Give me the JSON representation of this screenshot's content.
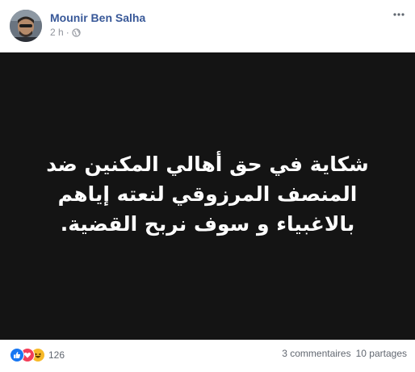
{
  "post": {
    "author": "Mounir Ben Salha",
    "time": "2 h",
    "separator": "·",
    "privacy_icon": "globe-icon",
    "text": "شكاية في حق أهالي المكنين ضد المنصف المرزوقي لنعته إياهم بالاغبياء و سوف نربح القضية.",
    "background_color": "#141414",
    "text_color": "#ffffff"
  },
  "footer": {
    "reactions": [
      "like-icon",
      "love-icon",
      "haha-icon"
    ],
    "reaction_count": "126",
    "comments": "3 commentaires",
    "shares": "10 partages"
  },
  "colors": {
    "author_link": "#385898",
    "meta_text": "#90949c",
    "like": "#1877f2",
    "love": "#f33e58",
    "haha": "#f7b928"
  }
}
